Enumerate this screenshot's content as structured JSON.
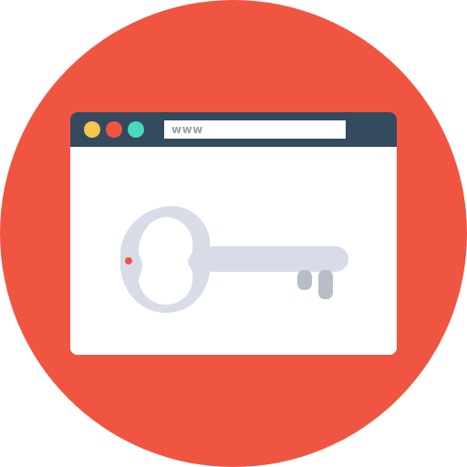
{
  "background": {
    "icon": "circle",
    "color": "#F05542"
  },
  "browser": {
    "window_dots": [
      {
        "name": "yellow",
        "color": "#F5C54C"
      },
      {
        "name": "red",
        "color": "#F05542"
      },
      {
        "name": "green",
        "color": "#4CD7C0"
      }
    ],
    "address_bar": {
      "text": "www"
    },
    "content": {
      "icon": "key-icon",
      "key_color": "#D8DCE6",
      "key_shadow": "#B8BEC8",
      "hole_color": "#F05542"
    }
  }
}
